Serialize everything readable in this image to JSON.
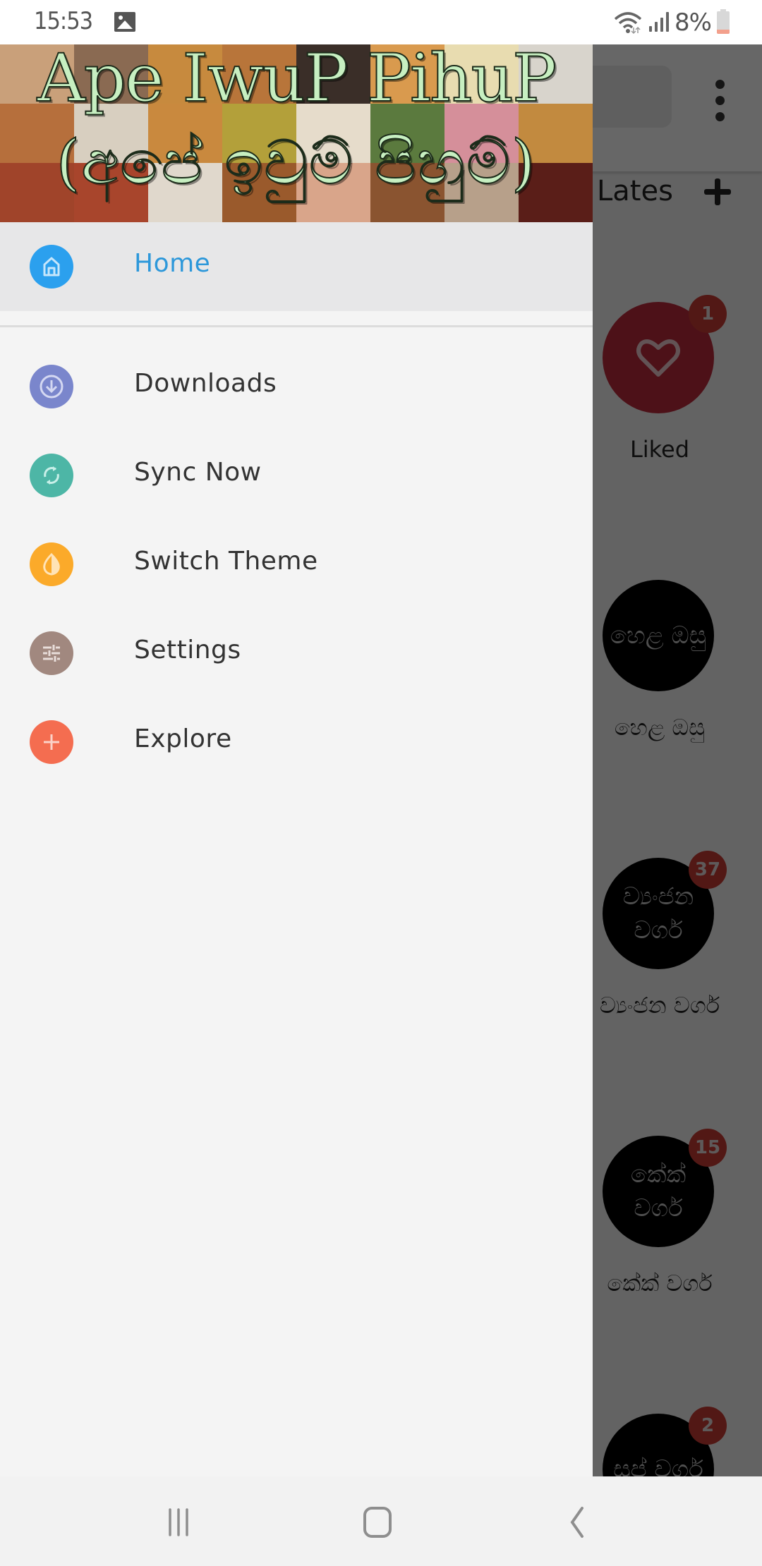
{
  "status_bar": {
    "time": "15:53",
    "notification_icon": "gallery-icon",
    "battery_percent": "8%",
    "icons": [
      "wifi-icon",
      "signal-icon",
      "battery-icon"
    ]
  },
  "drawer": {
    "header": {
      "title_line1": "Ape IwuP PihuP",
      "title_line2": "(අපේ ඉවුම් පිහුම්)"
    },
    "items": [
      {
        "label": "Home",
        "icon": "home-icon",
        "color": "#2ba0ee",
        "active": true
      },
      {
        "label": "Downloads",
        "icon": "download-icon",
        "color": "#7a86cc",
        "active": false
      },
      {
        "label": "Sync Now",
        "icon": "sync-icon",
        "color": "#4db6a6",
        "active": false
      },
      {
        "label": "Switch Theme",
        "icon": "theme-icon",
        "color": "#fbaa2a",
        "active": false
      },
      {
        "label": "Settings",
        "icon": "sliders-icon",
        "color": "#a1887f",
        "active": false
      },
      {
        "label": "Explore",
        "icon": "plus-icon",
        "color": "#f46d50",
        "active": false
      }
    ]
  },
  "background_app": {
    "tab_label": "Lates",
    "add_button": "plus-icon",
    "menu_button": "more-vert-icon",
    "categories": [
      {
        "circle_text": "",
        "label": "Liked",
        "badge": "1",
        "icon": "heart-icon"
      },
      {
        "circle_text": "හෙළ ඔසු",
        "label": "හෙළ ඔසු",
        "badge": ""
      },
      {
        "circle_text": "ව්‍යංජන වර්ග",
        "label": "ව්‍යංජන වර්ග",
        "badge": "37"
      },
      {
        "circle_text": "කේක් වර්ග",
        "label": "කේක් වර්ග",
        "badge": "15"
      },
      {
        "circle_text": "සුප් වර්ග",
        "label": "",
        "badge": "2"
      }
    ]
  },
  "system_nav": {
    "buttons": [
      "recents-icon",
      "home-button-icon",
      "back-icon"
    ]
  }
}
